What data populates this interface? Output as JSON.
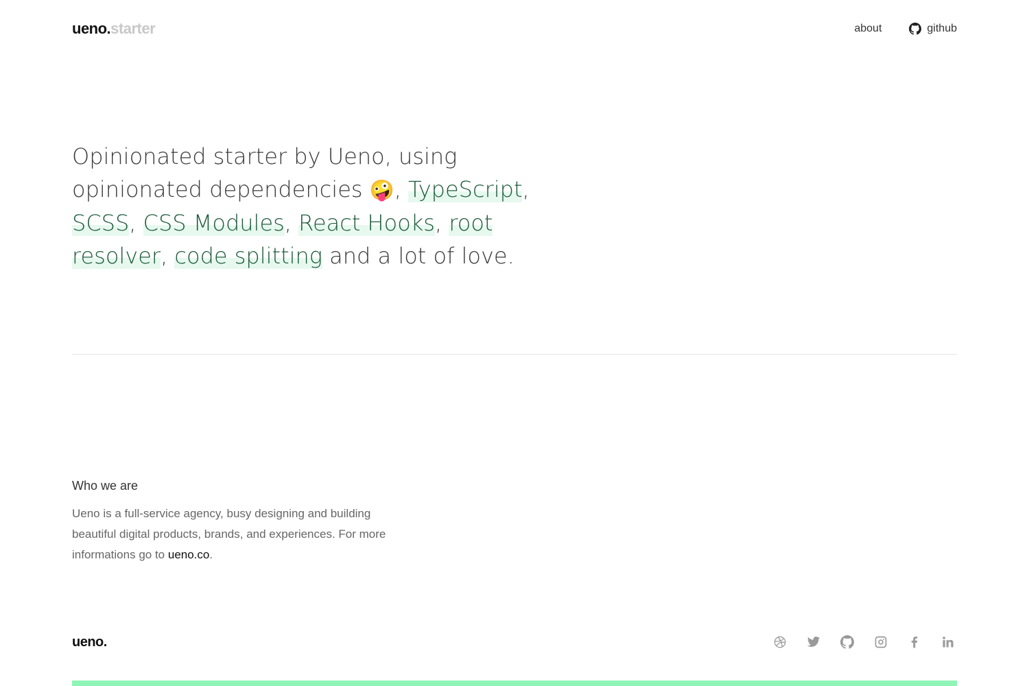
{
  "header": {
    "logo_main": "ueno.",
    "logo_sub": "starter",
    "nav": {
      "about_label": "about",
      "github_label": "github",
      "github_icon": "github-icon"
    }
  },
  "hero": {
    "intro": "Opinionated starter by Ueno, using opinionated dependencies",
    "emoji": "🤪",
    "sep": ", ",
    "links": [
      "TypeScript",
      "SCSS",
      "CSS Modules",
      "React Hooks",
      "root resolver",
      "code splitting"
    ],
    "outro": " and a lot of love."
  },
  "about": {
    "heading": "Who we are",
    "text": "Ueno is a full-service agency, busy designing and building beautiful digital products, brands, and experiences. For more informations go to ",
    "link_label": "ueno.co",
    "period": "."
  },
  "footer": {
    "logo": "ueno.",
    "social_icons": [
      "dribbble-icon",
      "twitter-icon",
      "github-icon",
      "instagram-icon",
      "facebook-icon",
      "linkedin-icon"
    ]
  },
  "colors": {
    "accent_bar": "#8ef5b6",
    "highlight_bg": "#e7f9ef",
    "highlight_text": "#1e5b3b"
  }
}
